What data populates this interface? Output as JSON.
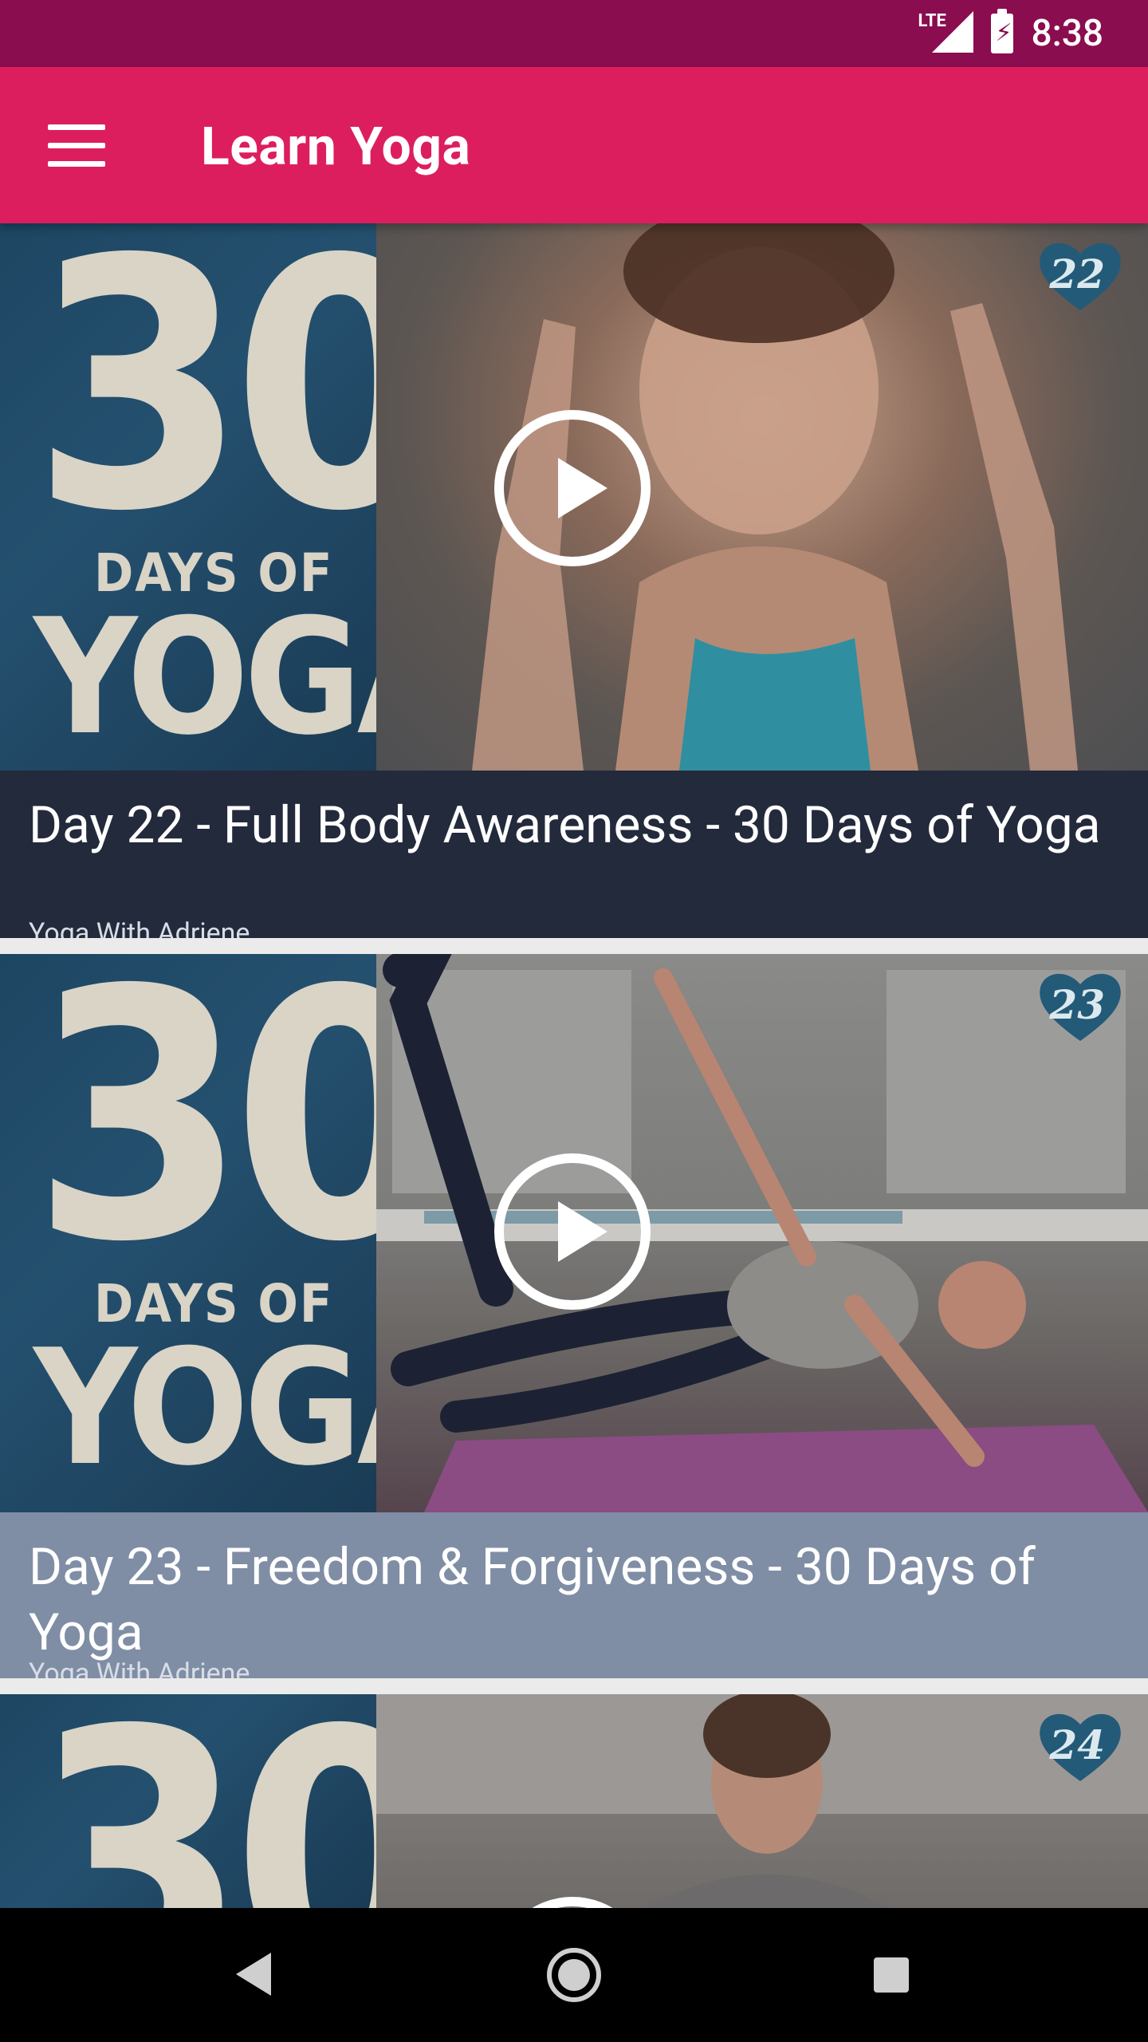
{
  "status_bar": {
    "network": "LTE",
    "time": "8:38"
  },
  "app_bar": {
    "title": "Learn Yoga",
    "menu_icon": "hamburger-menu-icon"
  },
  "videos": [
    {
      "title": "Day 22 - Full Body Awareness - 30 Days of Yoga",
      "channel": "Yoga With Adriene",
      "thumbnail": {
        "series_line1": "30",
        "series_line2": "DAYS OF",
        "series_line3": "YOGA",
        "day_badge": "22"
      },
      "caption_color": "#232a3c"
    },
    {
      "title": "Day 23 - Freedom & Forgiveness - 30 Days of Yoga",
      "channel": "Yoga With Adriene",
      "thumbnail": {
        "series_line1": "30",
        "series_line2": "DAYS OF",
        "series_line3": "YOGA",
        "day_badge": "23"
      },
      "caption_color": "#7f8ea5"
    },
    {
      "title": "",
      "channel": "",
      "thumbnail": {
        "series_line1": "30",
        "series_line2": "",
        "series_line3": "",
        "day_badge": "24"
      }
    }
  ],
  "nav_bar": {
    "back_icon": "back-triangle-icon",
    "home_icon": "home-circle-icon",
    "recents_icon": "recents-square-icon"
  },
  "colors": {
    "status_bar": "#8a0d4f",
    "app_bar": "#dc1e5f",
    "nav_bar": "#000000"
  }
}
